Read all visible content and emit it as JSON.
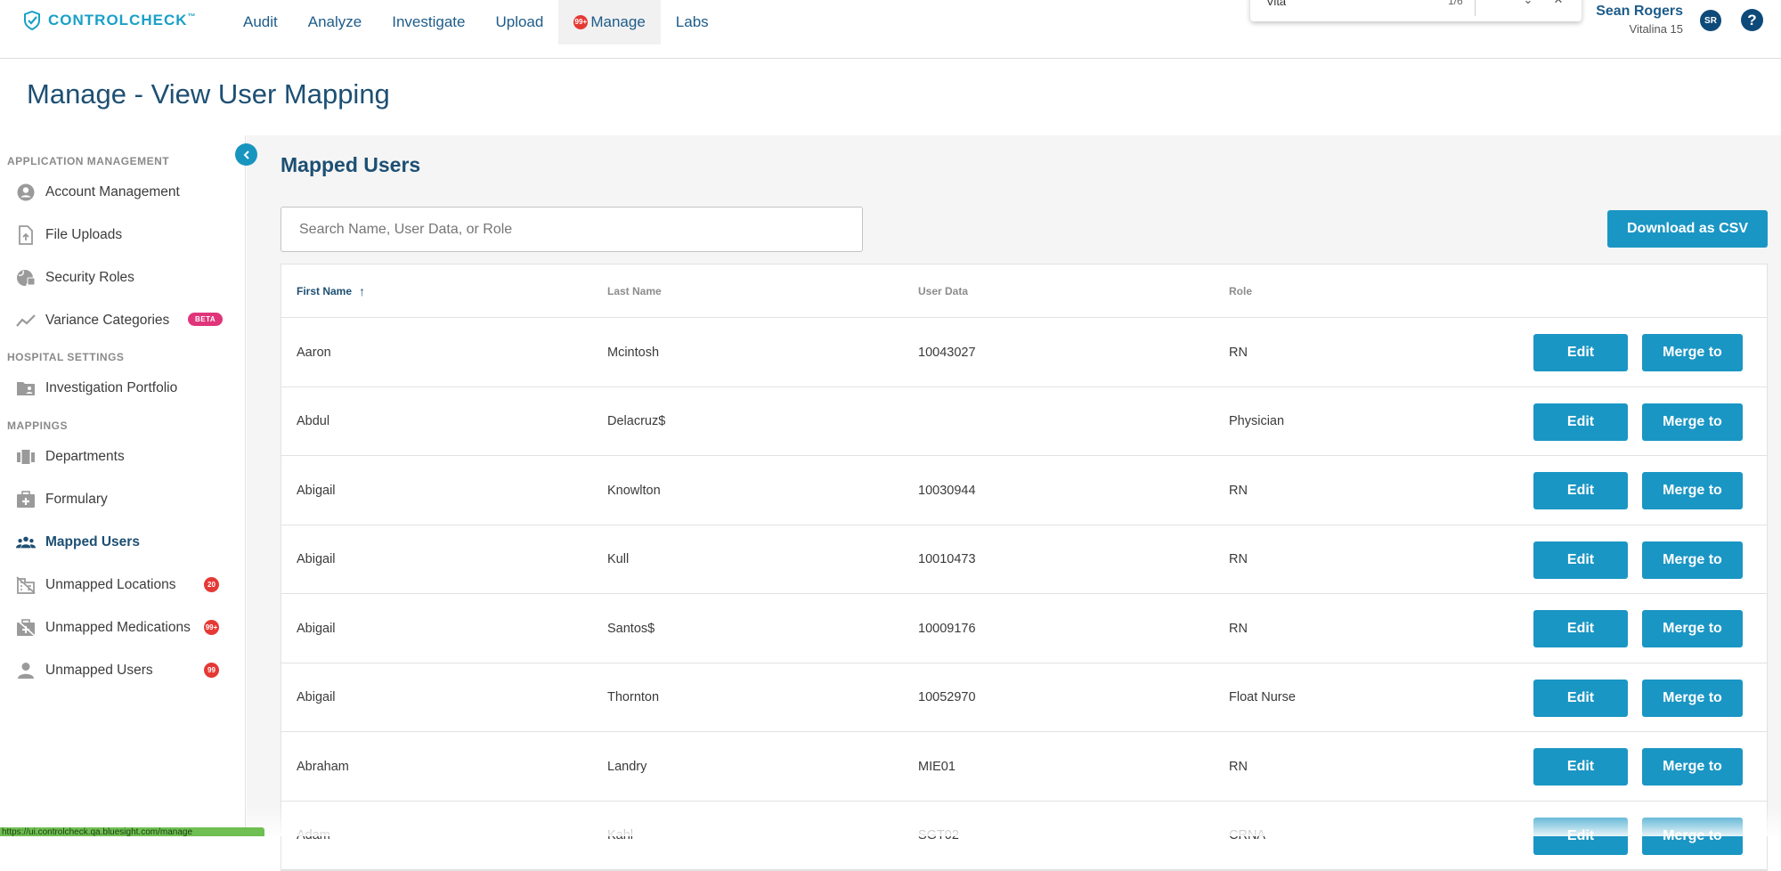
{
  "brand": {
    "name": "CONTROLCHECK",
    "tm": "™",
    "color": "#1aa0c8"
  },
  "nav": {
    "items": [
      {
        "label": "Audit"
      },
      {
        "label": "Analyze"
      },
      {
        "label": "Investigate"
      },
      {
        "label": "Upload"
      },
      {
        "label": "Manage",
        "badge": "99+"
      },
      {
        "label": "Labs"
      }
    ],
    "active": "Manage"
  },
  "find_bar": {
    "query": "Vita",
    "count": "1/6"
  },
  "user": {
    "name": "Sean Rogers",
    "site": "Vitalina 15",
    "initials": "SR",
    "help": "?"
  },
  "page_title": "Manage - View User Mapping",
  "sidebar": {
    "sections": [
      {
        "label": "APPLICATION MANAGEMENT",
        "items": [
          {
            "label": "Account Management",
            "icon": "account-circle-icon"
          },
          {
            "label": "File Uploads",
            "icon": "file-upload-icon"
          },
          {
            "label": "Security Roles",
            "icon": "security-globe-icon"
          },
          {
            "label": "Variance Categories",
            "icon": "trending-line-icon",
            "tag": "BETA"
          }
        ]
      },
      {
        "label": "HOSPITAL SETTINGS",
        "items": [
          {
            "label": "Investigation Portfolio",
            "icon": "folder-user-icon"
          }
        ]
      },
      {
        "label": "MAPPINGS",
        "items": [
          {
            "label": "Departments",
            "icon": "departments-icon"
          },
          {
            "label": "Formulary",
            "icon": "medical-bag-icon"
          },
          {
            "label": "Mapped Users",
            "icon": "people-icon",
            "active": true
          },
          {
            "label": "Unmapped Locations",
            "icon": "location-off-icon",
            "badge": "20"
          },
          {
            "label": "Unmapped Medications",
            "icon": "medication-off-icon",
            "badge": "99+"
          },
          {
            "label": "Unmapped Users",
            "icon": "person-icon",
            "badge": "99"
          }
        ]
      }
    ]
  },
  "main": {
    "title": "Mapped Users",
    "search_placeholder": "Search Name, User Data, or Role",
    "download_label": "Download as CSV",
    "table": {
      "columns": [
        "First Name",
        "Last Name",
        "User Data",
        "Role"
      ],
      "sorted_column": "First Name",
      "sort_direction": "ascending",
      "edit_label": "Edit",
      "merge_label": "Merge to",
      "rows": [
        {
          "first": "Aaron",
          "last": "Mcintosh",
          "data": "10043027",
          "role": "RN"
        },
        {
          "first": "Abdul",
          "last": "Delacruz$",
          "data": "",
          "role": "Physician"
        },
        {
          "first": "Abigail",
          "last": "Knowlton",
          "data": "10030944",
          "role": "RN"
        },
        {
          "first": "Abigail",
          "last": "Kull",
          "data": "10010473",
          "role": "RN"
        },
        {
          "first": "Abigail",
          "last": "Santos$",
          "data": "10009176",
          "role": "RN"
        },
        {
          "first": "Abigail",
          "last": "Thornton",
          "data": "10052970",
          "role": "Float Nurse"
        },
        {
          "first": "Abraham",
          "last": "Landry",
          "data": "MIE01",
          "role": "RN"
        },
        {
          "first": "Adam",
          "last": "Kahl",
          "data": "SGT02",
          "role": "CRNA"
        }
      ]
    }
  },
  "status_url": "https://ui.controlcheck.qa.bluesight.com/manage",
  "colors": {
    "primary_button": "#1a96c4",
    "title": "#1d4f73",
    "badge_red": "#e53935",
    "beta_pink": "#e0357a"
  }
}
